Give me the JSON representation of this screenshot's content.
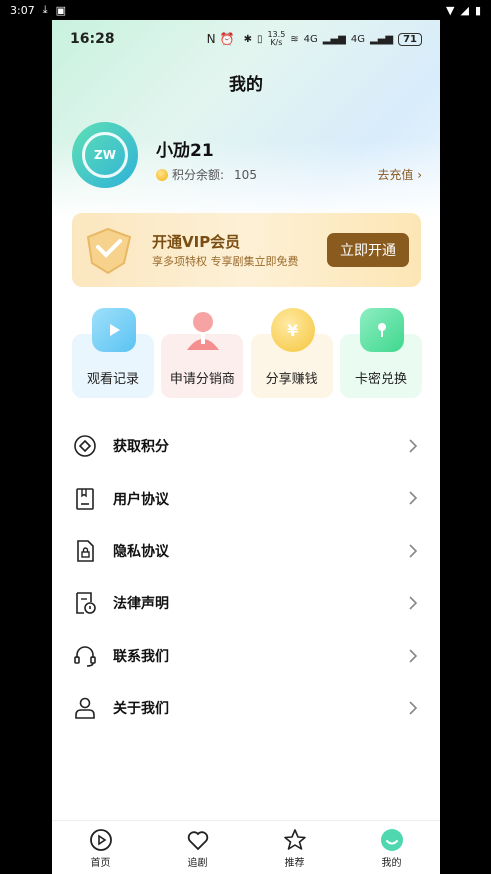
{
  "system_bar": {
    "time": "3:07"
  },
  "status_bar": {
    "time": "16:28",
    "net_speed": "13.5\nK/s",
    "network1": "4G",
    "network2": "4G",
    "battery": "71"
  },
  "page": {
    "title": "我的"
  },
  "profile": {
    "username": "小劢21",
    "points_label": "积分余额:",
    "points_value": "105",
    "recharge_label": "去充值"
  },
  "vip": {
    "title": "开通VIP会员",
    "subtitle": "享多项特权 专享剧集立即免费",
    "button": "立即开通"
  },
  "shortcuts": [
    {
      "label": "观看记录",
      "icon": "play-icon",
      "color": "#7fd0f5",
      "bg": "#eaf6fd"
    },
    {
      "label": "申请分销商",
      "icon": "person-icon",
      "color": "#f7a3a3",
      "bg": "#fdeeee"
    },
    {
      "label": "分享赚钱",
      "icon": "yen-coin-icon",
      "color": "#f8d26a",
      "bg": "#fdf6e6"
    },
    {
      "label": "卡密兑换",
      "icon": "ticket-icon",
      "color": "#6fe0a8",
      "bg": "#eafbf2"
    }
  ],
  "menu": [
    {
      "label": "获取积分",
      "icon": "points-icon"
    },
    {
      "label": "用户协议",
      "icon": "agreement-icon"
    },
    {
      "label": "隐私协议",
      "icon": "privacy-icon"
    },
    {
      "label": "法律声明",
      "icon": "legal-icon"
    },
    {
      "label": "联系我们",
      "icon": "headset-icon"
    },
    {
      "label": "关于我们",
      "icon": "user-icon"
    }
  ],
  "tabs": [
    {
      "label": "首页",
      "icon": "play-circle-icon"
    },
    {
      "label": "追剧",
      "icon": "heart-icon"
    },
    {
      "label": "推荐",
      "icon": "star-icon"
    },
    {
      "label": "我的",
      "icon": "profile-tab-icon",
      "active": true
    }
  ],
  "colors": {
    "vip_button": "#8a5b1e",
    "vip_text": "#7a4e12",
    "hero_green": "#c9f2df"
  }
}
